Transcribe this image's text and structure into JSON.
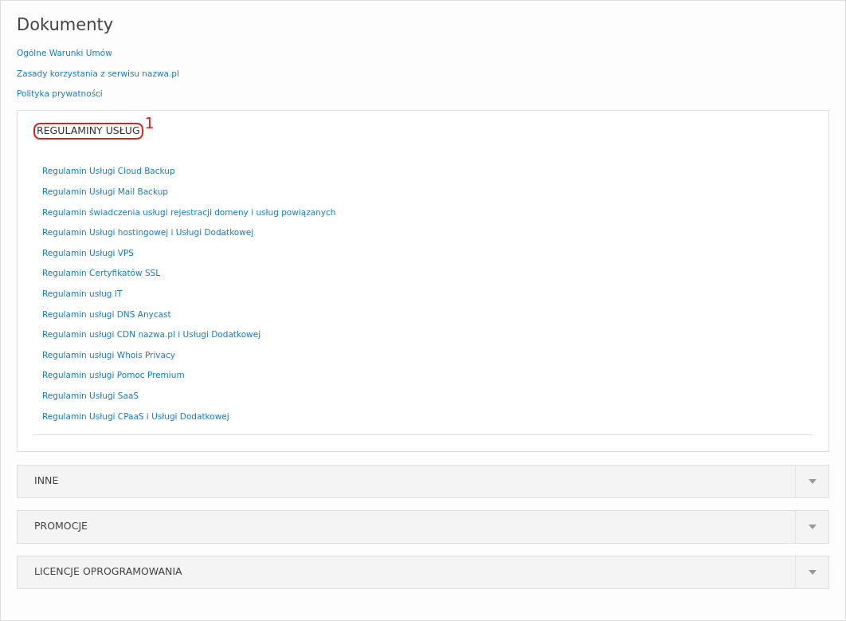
{
  "title": "Dokumenty",
  "links": [
    "Ogólne Warunki Umów",
    "Zasady korzystania z serwisu nazwa.pl",
    "Polityka prywatności"
  ],
  "sections": [
    {
      "title": "REGULAMINY USŁUG",
      "expanded": true,
      "annotation_label": "1",
      "links": [
        "Regulamin Usługi Cloud Backup",
        "Regulamin Usługi Mail Backup",
        "Regulamin świadczenia usługi rejestracji domeny i usług powiązanych",
        "Regulamin Usługi hostingowej i Usługi Dodatkowej",
        "Regulamin Usługi VPS",
        "Regulamin Certyfikatów SSL",
        "Regulamin usług IT",
        "Regulamin usługi DNS Anycast",
        "Regulamin usługi CDN nazwa.pl i Usługi Dodatkowej",
        "Regulamin usługi Whois Privacy",
        "Regulamin usługi Pomoc Premium",
        "Regulamin Usługi SaaS",
        "Regulamin Usługi CPaaS i Usługi Dodatkowej"
      ]
    },
    {
      "title": "INNE",
      "expanded": false
    },
    {
      "title": "PROMOCJE",
      "expanded": false
    },
    {
      "title": "LICENCJE OPROGRAMOWANIA",
      "expanded": false
    }
  ]
}
